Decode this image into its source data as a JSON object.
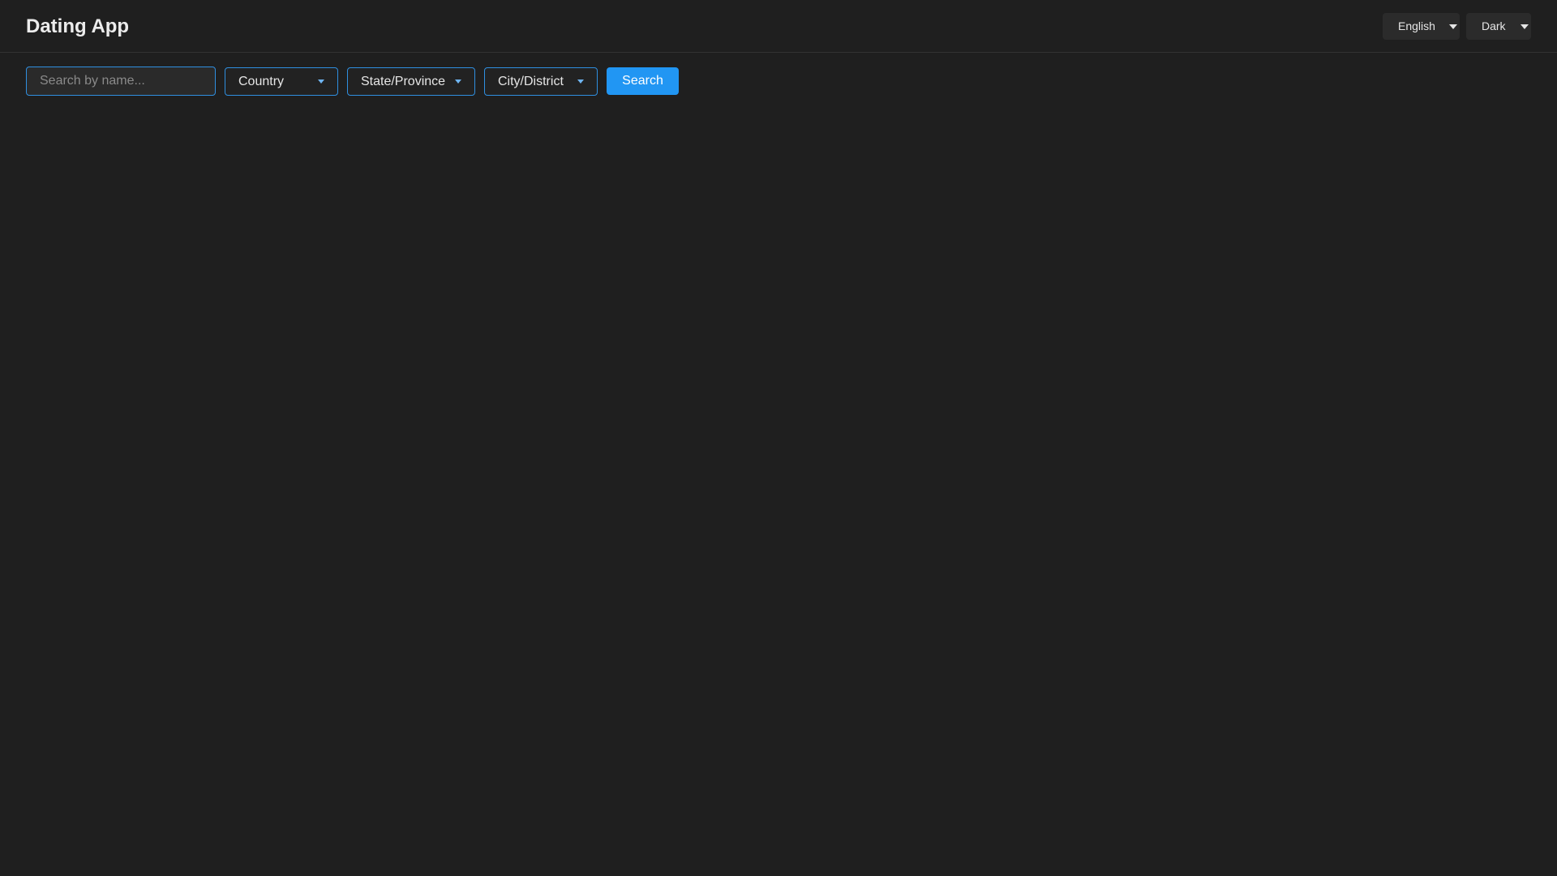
{
  "header": {
    "title": "Dating App",
    "language": {
      "selected": "English"
    },
    "theme": {
      "selected": "Dark"
    }
  },
  "filters": {
    "search": {
      "placeholder": "Search by name...",
      "value": ""
    },
    "country": {
      "label": "Country"
    },
    "state": {
      "label": "State/Province"
    },
    "city": {
      "label": "City/District"
    },
    "search_button_label": "Search"
  },
  "colors": {
    "background": "#1f1f1f",
    "accent": "#2196f3",
    "border_accent": "#2f8fe0"
  },
  "icons": {
    "dropdown": "chevron-down-icon"
  }
}
